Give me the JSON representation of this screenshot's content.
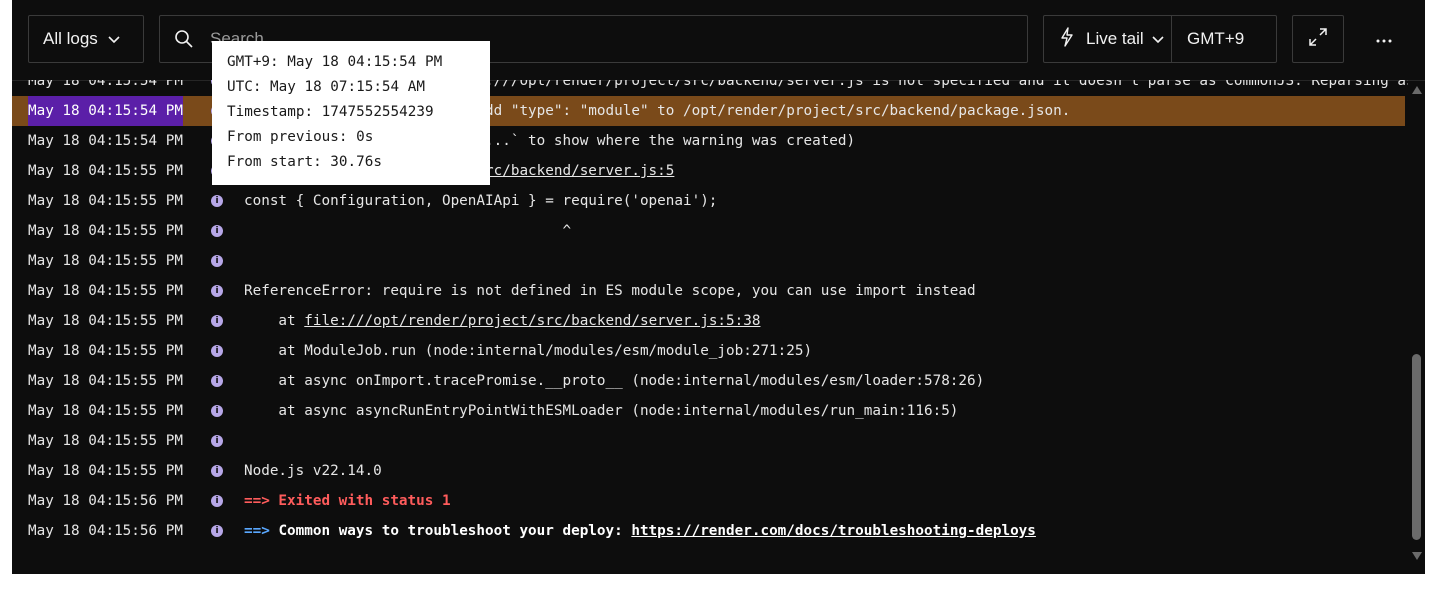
{
  "toolbar": {
    "filter_label": "All logs",
    "search_placeholder": "Search",
    "live_tail_label": "Live tail",
    "timezone_label": "GMT+9"
  },
  "tooltip": {
    "lines": [
      "GMT+9: May 18 04:15:54 PM",
      "UTC: May 18 07:15:54 AM",
      "Timestamp: 1747552554239",
      "From previous: 0s",
      "From start: 30.76s"
    ]
  },
  "log": {
    "rows": [
      {
        "ts": "May 18 04:15:54 PM",
        "parts": [
          {
            "t": "Warning: Module type of file:///opt/render/project/src/backend/server.js is not specified and it doesn't parse as CommonJS. Reparsing as ES module because module syntax was detected. This incurs a performance overhead."
          }
        ]
      },
      {
        "ts": "May 18 04:15:54 PM",
        "parts": [
          {
            "t": "To eliminate this warning, add \"type\": \"module\" to /opt/render/project/src/backend/package.json."
          }
        ]
      },
      {
        "ts": "May 18 04:15:54 PM",
        "parts": [
          {
            "t": "(Use `node --trace-warnings ...` to show where the warning was created)"
          }
        ]
      },
      {
        "ts": "May 18 04:15:55 PM",
        "parts": [
          {
            "t": "file:///opt/render/project/src/backend/server.js:5",
            "c": "link"
          }
        ]
      },
      {
        "ts": "May 18 04:15:55 PM",
        "parts": [
          {
            "t": "const { Configuration, OpenAIApi } = require('openai');"
          }
        ]
      },
      {
        "ts": "May 18 04:15:55 PM",
        "parts": [
          {
            "t": "                                     ^"
          }
        ]
      },
      {
        "ts": "May 18 04:15:55 PM",
        "parts": []
      },
      {
        "ts": "May 18 04:15:55 PM",
        "parts": [
          {
            "t": "ReferenceError: require is not defined in ES module scope, you can use import instead"
          }
        ]
      },
      {
        "ts": "May 18 04:15:55 PM",
        "parts": [
          {
            "t": "    at "
          },
          {
            "t": "file:///opt/render/project/src/backend/server.js:5:38",
            "c": "link"
          }
        ]
      },
      {
        "ts": "May 18 04:15:55 PM",
        "parts": [
          {
            "t": "    at ModuleJob.run (node:internal/modules/esm/module_job:271:25)"
          }
        ]
      },
      {
        "ts": "May 18 04:15:55 PM",
        "parts": [
          {
            "t": "    at async onImport.tracePromise.__proto__ (node:internal/modules/esm/loader:578:26)"
          }
        ]
      },
      {
        "ts": "May 18 04:15:55 PM",
        "parts": [
          {
            "t": "    at async asyncRunEntryPointWithESMLoader (node:internal/modules/run_main:116:5)"
          }
        ]
      },
      {
        "ts": "May 18 04:15:55 PM",
        "parts": []
      },
      {
        "ts": "May 18 04:15:55 PM",
        "parts": [
          {
            "t": "Node.js v22.14.0"
          }
        ]
      },
      {
        "ts": "May 18 04:15:56 PM",
        "parts": [
          {
            "t": "==> Exited with status 1",
            "c": "red"
          }
        ]
      },
      {
        "ts": "May 18 04:15:56 PM",
        "parts": [
          {
            "t": "==> ",
            "c": "blue"
          },
          {
            "t": "Common ways to troubleshoot your deploy: ",
            "c": "bold"
          },
          {
            "t": "https://render.com/docs/troubleshooting-deploys",
            "c": "bold link"
          }
        ]
      }
    ],
    "highlighted_row": 1,
    "selected_timestamp_row": 1
  },
  "colors": {
    "background": "#0d0d0d",
    "highlight_row": "#7a4a1a",
    "selection": "#5b1fa8",
    "error": "#ff5c5c",
    "arrow": "#5aa8ff",
    "info_icon": "#b7a7e8"
  },
  "icons": [
    "chevron-down-icon",
    "search-icon",
    "lightning-icon",
    "expand-icon",
    "more-icon",
    "info-icon"
  ]
}
